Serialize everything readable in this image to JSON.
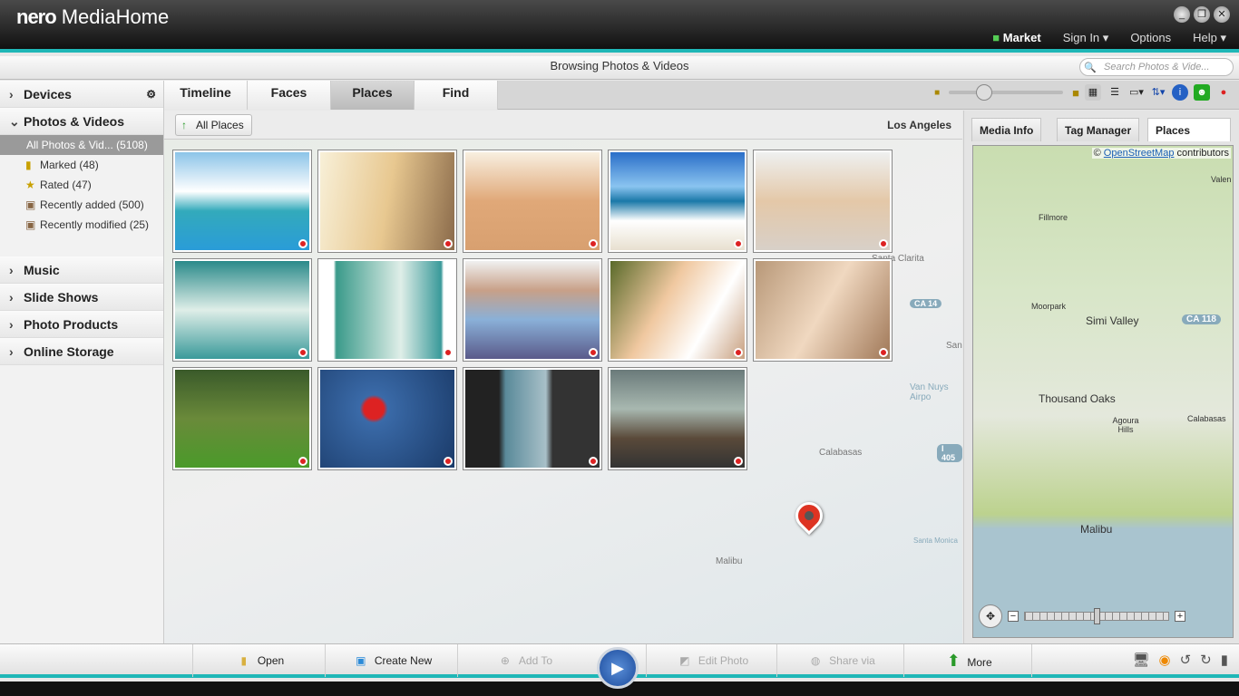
{
  "window": {
    "brand": "nero",
    "app": "MediaHome",
    "controls": [
      "_",
      "❐",
      "✕"
    ]
  },
  "topmenu": {
    "market": "Market",
    "signin": "Sign In ▾",
    "options": "Options",
    "help": "Help ▾"
  },
  "browse": {
    "title": "Browsing Photos & Videos",
    "search_placeholder": "Search Photos & Vide..."
  },
  "sidebar": {
    "devices": "Devices",
    "photos": "Photos & Videos",
    "items": [
      {
        "label": "All Photos & Vid... (5108)"
      },
      {
        "label": "Marked (48)"
      },
      {
        "label": "Rated (47)"
      },
      {
        "label": "Recently added (500)"
      },
      {
        "label": "Recently modified (25)"
      }
    ],
    "music": "Music",
    "slideshows": "Slide Shows",
    "products": "Photo Products",
    "storage": "Online Storage"
  },
  "tabs": [
    "Timeline",
    "Faces",
    "Places",
    "Find"
  ],
  "main": {
    "all_places": "All Places",
    "location": "Los Angeles",
    "map_labels": [
      "Santa Clarita",
      "CA 14",
      "San",
      "Van Nuys Airpo",
      "Calabasas",
      "I 405",
      "Malibu",
      "Santa Monica"
    ]
  },
  "right": {
    "tabs": [
      "Media Info",
      "Tag Manager",
      "Places"
    ],
    "attribution_prefix": "©",
    "attribution_link": "OpenStreetMap",
    "attribution_suffix": "contributors",
    "map_labels": [
      "Fillmore",
      "Valen",
      "Moorpark",
      "Simi Valley",
      "CA 118",
      "Thousand Oaks",
      "Agoura Hills",
      "Calabasas",
      "Malibu"
    ]
  },
  "bottom": {
    "open": "Open",
    "create": "Create New",
    "add": "Add To",
    "edit": "Edit Photo",
    "share": "Share via",
    "more": "More"
  },
  "colors": {
    "accent": "#1fb7b7",
    "pin": "#d22222"
  }
}
